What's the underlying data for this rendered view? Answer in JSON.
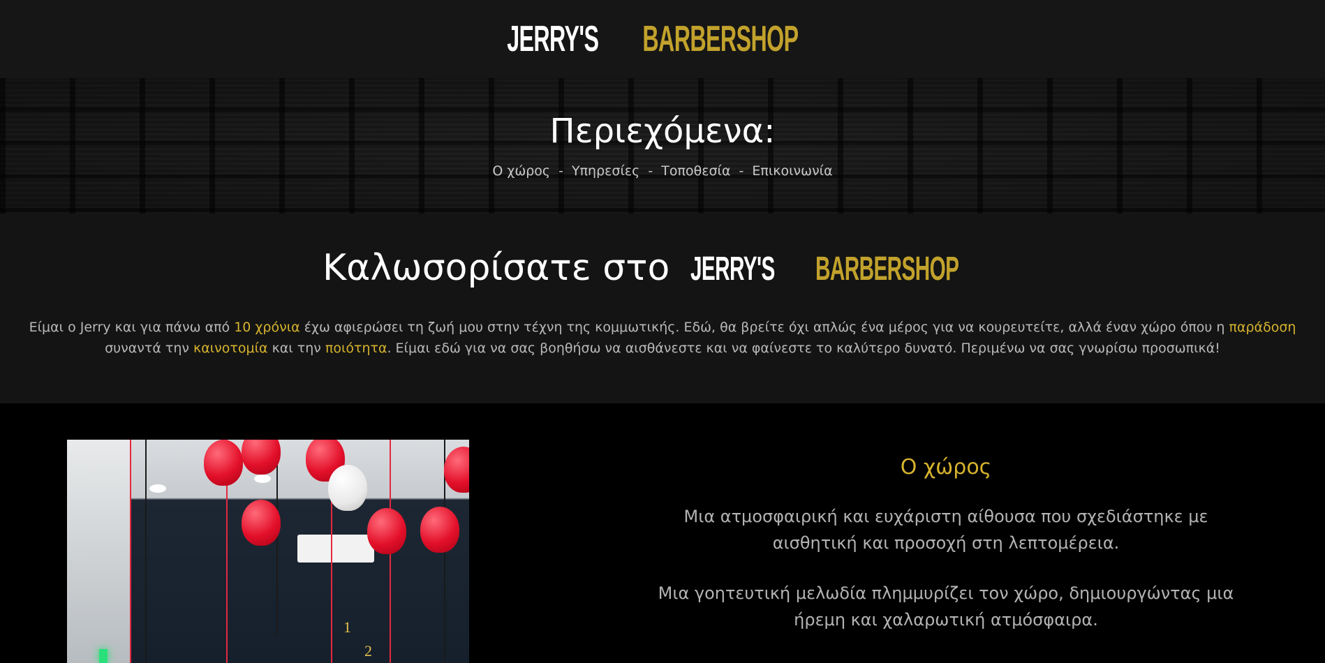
{
  "header": {
    "logo_white": "JERRY'S",
    "logo_gold": "BARBERSHOP"
  },
  "hero": {
    "title": "Περιεχόμενα:",
    "nav": [
      "Ο χώρος",
      "Υπηρεσίες",
      "Τοποθεσία",
      "Επικοινωνία"
    ],
    "separator": "-"
  },
  "welcome": {
    "title_prefix": "Καλωσορίσατε στο",
    "logo_white": "JERRY'S",
    "logo_gold": "BARBERSHOP",
    "text": {
      "part1": "Είμαι ο Jerry και για πάνω από ",
      "hl1": "10 χρόνια",
      "part2": " έχω αφιερώσει τη ζωή μου στην τέχνη της κομμωτικής. Εδώ, θα βρείτε όχι απλώς ένα μέρος για να κουρευτείτε, αλλά έναν χώρο όπου η ",
      "hl2": "παράδοση",
      "part3": " συναντά την ",
      "hl3": "καινοτομία",
      "part4": " και την ",
      "hl4": "ποιότητα",
      "part5": ". Είμαι εδώ για να σας βοηθήσω να αισθάνεστε και να φαίνεστε το καλύτερο δυνατό. Περιμένω να σας γνωρίσω προσωπικά!"
    }
  },
  "space": {
    "heading": "Ο χώρος",
    "paragraph1": "Μια ατμοσφαιρική και ευχάριστη αίθουσα που σχεδιάστηκε με αισθητική και προσοχή στη λεπτομέρεια.",
    "paragraph2": "Μια γοητευτική μελωδία πλημμυρίζει τον χώρο, δημιουργώντας μια ήρεμη και χαλαρωτική ατμόσφαιρα.",
    "photo": {
      "clock_digits": [
        "1",
        "2"
      ]
    }
  },
  "colors": {
    "accent_gold": "#c2a22c",
    "highlight_gold": "#d6b32e",
    "header_bg": "#161616",
    "welcome_bg": "#141414",
    "section_bg": "#000000"
  }
}
